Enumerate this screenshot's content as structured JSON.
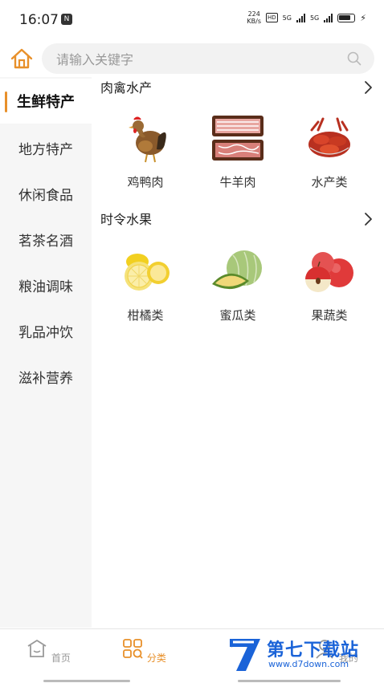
{
  "status": {
    "time": "16:07",
    "app_badge": "N",
    "speed_value": "224",
    "speed_unit": "KB/s",
    "hd": "HD",
    "net1": "5G",
    "net2": "5G"
  },
  "search": {
    "placeholder": "请输入关键字"
  },
  "sidebar": {
    "items": [
      {
        "label": "生鲜特产",
        "active": true
      },
      {
        "label": "地方特产"
      },
      {
        "label": "休闲食品"
      },
      {
        "label": "茗茶名酒"
      },
      {
        "label": "粮油调味"
      },
      {
        "label": "乳品冲饮"
      },
      {
        "label": "滋补营养"
      }
    ]
  },
  "sections": [
    {
      "title": "肉禽水产",
      "items": [
        {
          "label": "鸡鸭肉",
          "icon": "chicken-icon"
        },
        {
          "label": "牛羊肉",
          "icon": "sliced-meat-icon"
        },
        {
          "label": "水产类",
          "icon": "crayfish-icon"
        }
      ]
    },
    {
      "title": "时令水果",
      "items": [
        {
          "label": "柑橘类",
          "icon": "lemon-icon"
        },
        {
          "label": "蜜瓜类",
          "icon": "melon-icon"
        },
        {
          "label": "果蔬类",
          "icon": "apple-icon"
        }
      ]
    }
  ],
  "tabbar": {
    "tabs": [
      {
        "label": "首页",
        "icon": "home-tab-icon"
      },
      {
        "label": "分类",
        "icon": "category-tab-icon",
        "active": true
      },
      {
        "label": "",
        "icon": "cart-tab-icon"
      },
      {
        "label": "我的",
        "icon": "profile-tab-icon"
      }
    ]
  },
  "watermark": {
    "title": "第七下载站",
    "url": "www.d7down.com"
  },
  "colors": {
    "accent": "#e8902a",
    "watermark": "#1a63d8"
  }
}
